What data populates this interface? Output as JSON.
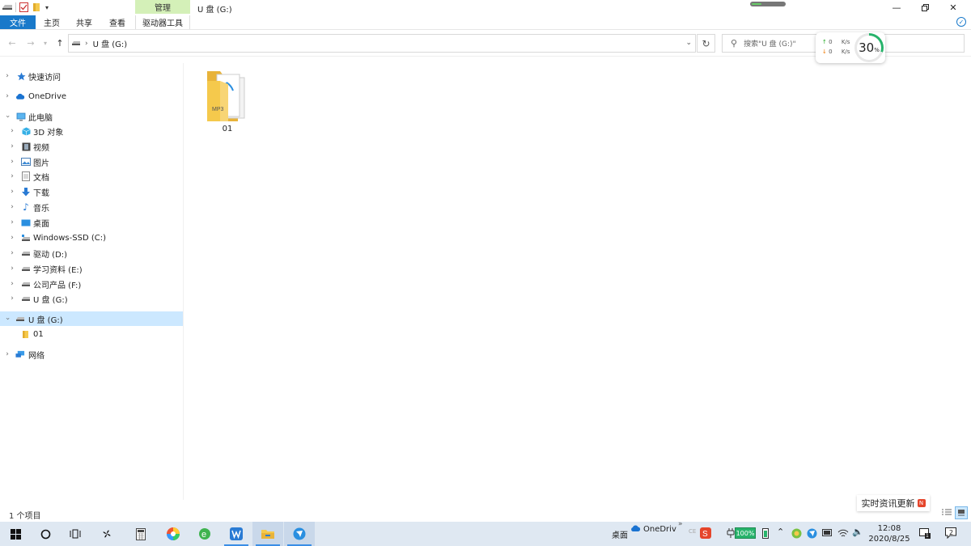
{
  "window": {
    "title": "U 盘 (G:)",
    "manage_tab": "管理",
    "progress": 0.3
  },
  "ribbon": {
    "tabs": [
      "文件",
      "主页",
      "共享",
      "查看",
      "驱动器工具"
    ]
  },
  "address": {
    "path": "U 盘 (G:)",
    "search_placeholder": "搜索\"U 盘 (G:)\""
  },
  "network": {
    "up_value": "0",
    "up_unit": "K/s",
    "down_value": "0",
    "down_unit": "K/s",
    "percent": "30",
    "percent_sign": "%",
    "percent_value": 30
  },
  "nav": {
    "quick_access": "快速访问",
    "onedrive": "OneDrive",
    "this_pc": "此电脑",
    "pc_items": [
      "3D 对象",
      "视频",
      "图片",
      "文档",
      "下载",
      "音乐",
      "桌面",
      "Windows-SSD (C:)",
      "驱动 (D:)",
      "学习资料 (E:)",
      "公司产品 (F:)",
      "U 盘 (G:)"
    ],
    "selected": "U 盘 (G:)",
    "selected_child": "01",
    "network": "网络"
  },
  "content": {
    "items": [
      {
        "name": "01",
        "badge": "MP3"
      }
    ]
  },
  "status": {
    "count_text": "1 个项目",
    "news": "实时资讯更新",
    "news_badge": "N"
  },
  "taskbar": {
    "tray_desktop": "桌面",
    "tray_onedrive": "OneDriv",
    "tray_chevron": "»",
    "tray_ime": "CE",
    "battery": "100%",
    "time": "12:08",
    "date": "2020/8/25",
    "notify_count": "1",
    "action_count": "2"
  },
  "colors": {
    "accent": "#1979ca",
    "selected_bg": "#cce8ff",
    "manage_bg": "#d4f0b8",
    "folder": "#f5c94c",
    "taskbar": "#dfe8f2"
  }
}
